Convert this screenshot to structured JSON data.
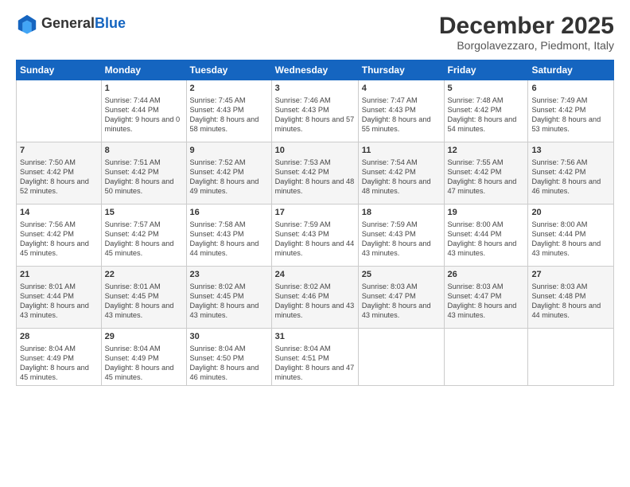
{
  "header": {
    "logo_line1": "General",
    "logo_line2": "Blue",
    "month_title": "December 2025",
    "subtitle": "Borgolavezzaro, Piedmont, Italy"
  },
  "days_of_week": [
    "Sunday",
    "Monday",
    "Tuesday",
    "Wednesday",
    "Thursday",
    "Friday",
    "Saturday"
  ],
  "weeks": [
    [
      {
        "day": "",
        "data": ""
      },
      {
        "day": "1",
        "data": "Sunrise: 7:44 AM\nSunset: 4:44 PM\nDaylight: 9 hours\nand 0 minutes."
      },
      {
        "day": "2",
        "data": "Sunrise: 7:45 AM\nSunset: 4:43 PM\nDaylight: 8 hours\nand 58 minutes."
      },
      {
        "day": "3",
        "data": "Sunrise: 7:46 AM\nSunset: 4:43 PM\nDaylight: 8 hours\nand 57 minutes."
      },
      {
        "day": "4",
        "data": "Sunrise: 7:47 AM\nSunset: 4:43 PM\nDaylight: 8 hours\nand 55 minutes."
      },
      {
        "day": "5",
        "data": "Sunrise: 7:48 AM\nSunset: 4:42 PM\nDaylight: 8 hours\nand 54 minutes."
      },
      {
        "day": "6",
        "data": "Sunrise: 7:49 AM\nSunset: 4:42 PM\nDaylight: 8 hours\nand 53 minutes."
      }
    ],
    [
      {
        "day": "7",
        "data": "Sunrise: 7:50 AM\nSunset: 4:42 PM\nDaylight: 8 hours\nand 52 minutes."
      },
      {
        "day": "8",
        "data": "Sunrise: 7:51 AM\nSunset: 4:42 PM\nDaylight: 8 hours\nand 50 minutes."
      },
      {
        "day": "9",
        "data": "Sunrise: 7:52 AM\nSunset: 4:42 PM\nDaylight: 8 hours\nand 49 minutes."
      },
      {
        "day": "10",
        "data": "Sunrise: 7:53 AM\nSunset: 4:42 PM\nDaylight: 8 hours\nand 48 minutes."
      },
      {
        "day": "11",
        "data": "Sunrise: 7:54 AM\nSunset: 4:42 PM\nDaylight: 8 hours\nand 48 minutes."
      },
      {
        "day": "12",
        "data": "Sunrise: 7:55 AM\nSunset: 4:42 PM\nDaylight: 8 hours\nand 47 minutes."
      },
      {
        "day": "13",
        "data": "Sunrise: 7:56 AM\nSunset: 4:42 PM\nDaylight: 8 hours\nand 46 minutes."
      }
    ],
    [
      {
        "day": "14",
        "data": "Sunrise: 7:56 AM\nSunset: 4:42 PM\nDaylight: 8 hours\nand 45 minutes."
      },
      {
        "day": "15",
        "data": "Sunrise: 7:57 AM\nSunset: 4:42 PM\nDaylight: 8 hours\nand 45 minutes."
      },
      {
        "day": "16",
        "data": "Sunrise: 7:58 AM\nSunset: 4:43 PM\nDaylight: 8 hours\nand 44 minutes."
      },
      {
        "day": "17",
        "data": "Sunrise: 7:59 AM\nSunset: 4:43 PM\nDaylight: 8 hours\nand 44 minutes."
      },
      {
        "day": "18",
        "data": "Sunrise: 7:59 AM\nSunset: 4:43 PM\nDaylight: 8 hours\nand 43 minutes."
      },
      {
        "day": "19",
        "data": "Sunrise: 8:00 AM\nSunset: 4:44 PM\nDaylight: 8 hours\nand 43 minutes."
      },
      {
        "day": "20",
        "data": "Sunrise: 8:00 AM\nSunset: 4:44 PM\nDaylight: 8 hours\nand 43 minutes."
      }
    ],
    [
      {
        "day": "21",
        "data": "Sunrise: 8:01 AM\nSunset: 4:44 PM\nDaylight: 8 hours\nand 43 minutes."
      },
      {
        "day": "22",
        "data": "Sunrise: 8:01 AM\nSunset: 4:45 PM\nDaylight: 8 hours\nand 43 minutes."
      },
      {
        "day": "23",
        "data": "Sunrise: 8:02 AM\nSunset: 4:45 PM\nDaylight: 8 hours\nand 43 minutes."
      },
      {
        "day": "24",
        "data": "Sunrise: 8:02 AM\nSunset: 4:46 PM\nDaylight: 8 hours\nand 43 minutes."
      },
      {
        "day": "25",
        "data": "Sunrise: 8:03 AM\nSunset: 4:47 PM\nDaylight: 8 hours\nand 43 minutes."
      },
      {
        "day": "26",
        "data": "Sunrise: 8:03 AM\nSunset: 4:47 PM\nDaylight: 8 hours\nand 43 minutes."
      },
      {
        "day": "27",
        "data": "Sunrise: 8:03 AM\nSunset: 4:48 PM\nDaylight: 8 hours\nand 44 minutes."
      }
    ],
    [
      {
        "day": "28",
        "data": "Sunrise: 8:04 AM\nSunset: 4:49 PM\nDaylight: 8 hours\nand 45 minutes."
      },
      {
        "day": "29",
        "data": "Sunrise: 8:04 AM\nSunset: 4:49 PM\nDaylight: 8 hours\nand 45 minutes."
      },
      {
        "day": "30",
        "data": "Sunrise: 8:04 AM\nSunset: 4:50 PM\nDaylight: 8 hours\nand 46 minutes."
      },
      {
        "day": "31",
        "data": "Sunrise: 8:04 AM\nSunset: 4:51 PM\nDaylight: 8 hours\nand 47 minutes."
      },
      {
        "day": "",
        "data": ""
      },
      {
        "day": "",
        "data": ""
      },
      {
        "day": "",
        "data": ""
      }
    ]
  ]
}
